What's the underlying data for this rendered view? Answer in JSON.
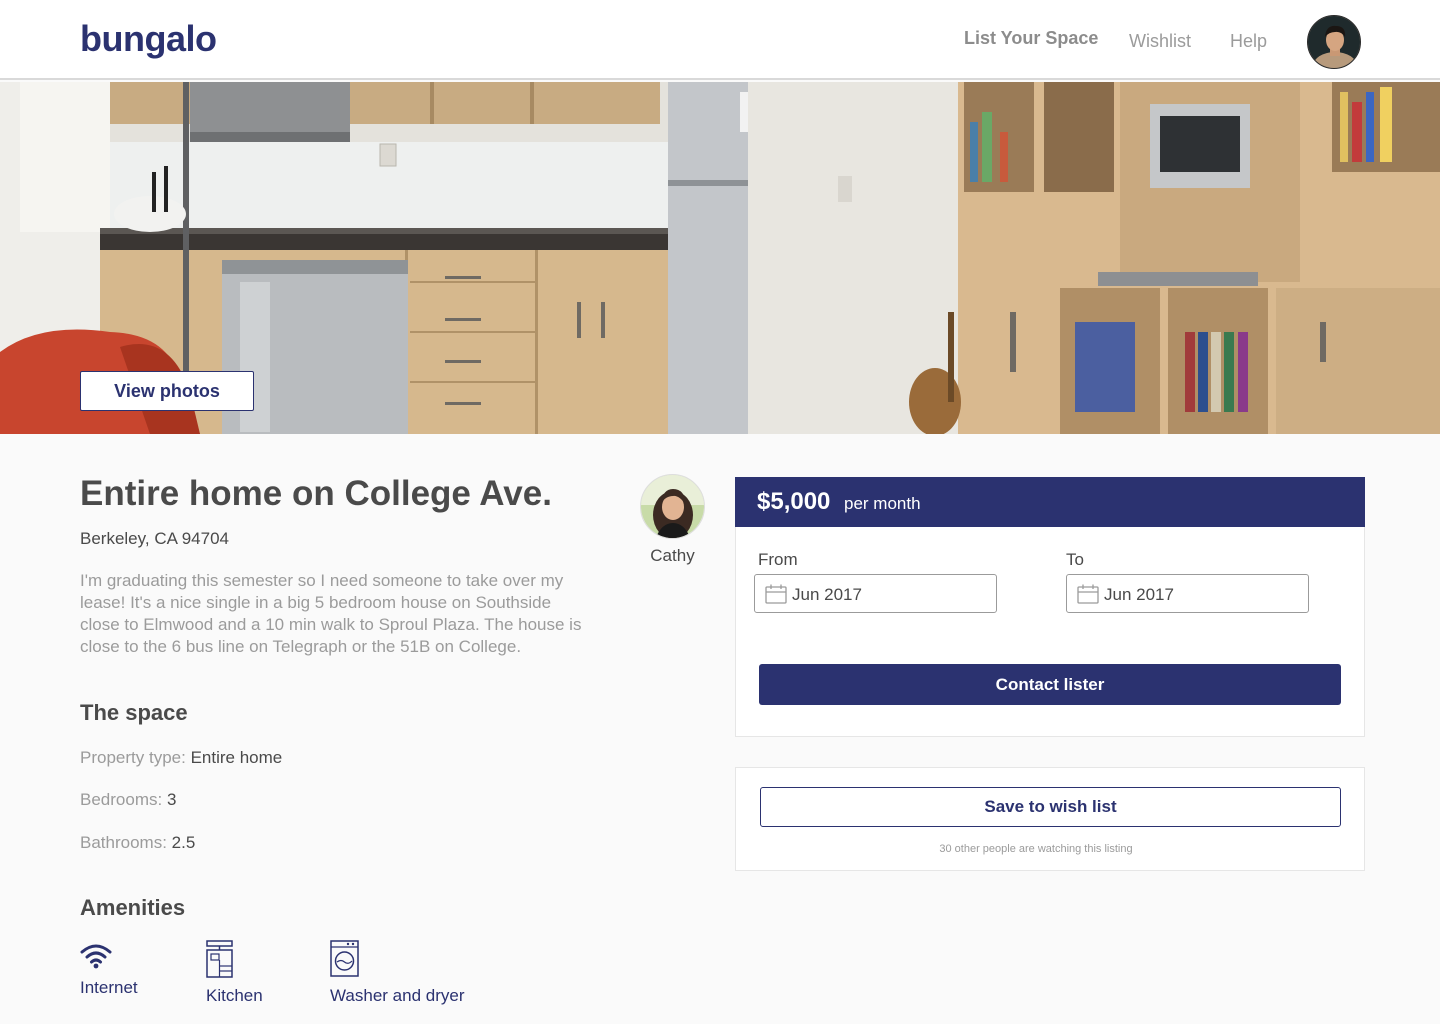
{
  "header": {
    "logo": "bungalo",
    "nav": {
      "list_space": "List Your Space",
      "wishlist": "Wishlist",
      "help": "Help"
    }
  },
  "hero": {
    "view_photos_label": "View photos"
  },
  "listing": {
    "title": "Entire home on College Ave.",
    "location": "Berkeley, CA 94704",
    "description": "I'm graduating this semester so I need someone to take over my lease! It's a nice single in a big 5 bedroom house on Southside close to Elmwood and a 10 min walk to Sproul Plaza. The house is close to the 6 bus line on Telegraph or the 51B on College.",
    "host_name": "Cathy"
  },
  "space": {
    "title": "The space",
    "property_type_label": "Property type:",
    "property_type": "Entire home",
    "bedrooms_label": "Bedrooms:",
    "bedrooms": "3",
    "bathrooms_label": "Bathrooms:",
    "bathrooms": "2.5"
  },
  "amenities": {
    "title": "Amenities",
    "items": [
      {
        "label": "Internet",
        "icon": "wifi-icon"
      },
      {
        "label": "Kitchen",
        "icon": "kitchen-icon"
      },
      {
        "label": "Washer and dryer",
        "icon": "washer-icon"
      }
    ]
  },
  "booking": {
    "price": "$5,000",
    "price_unit": "per month",
    "from_label": "From",
    "from_value": "Jun 2017",
    "to_label": "To",
    "to_value": "Jun 2017",
    "contact_label": "Contact lister"
  },
  "wishlist_card": {
    "save_label": "Save to wish list",
    "watching_note": "30 other people are watching this listing"
  },
  "colors": {
    "brand": "#2b3270",
    "muted_text": "#9b9b9b",
    "body_text": "#4a4a4a"
  }
}
